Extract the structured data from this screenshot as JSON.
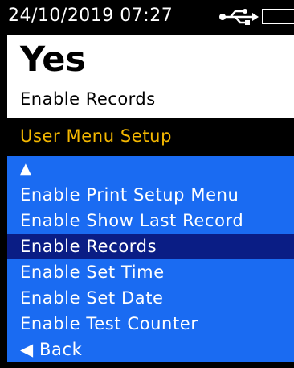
{
  "status": {
    "datetime": "24/10/2019 07:27",
    "usb_icon": "usb-icon",
    "battery_icon": "battery-icon"
  },
  "current": {
    "value": "Yes",
    "label": "Enable Records"
  },
  "menu": {
    "title": "User Menu Setup",
    "up_glyph": "▲",
    "items": [
      "Enable Print Setup Menu",
      "Enable Show Last Record",
      "Enable Records",
      "Enable Set Time",
      "Enable Set Date",
      "Enable Test Counter"
    ],
    "selected_item": "Enable Records",
    "back_label": "◀ Back"
  },
  "colors": {
    "menu_bg": "#1a6bf2",
    "selected_bg": "#0a1d85",
    "title_text": "#f5b800"
  }
}
